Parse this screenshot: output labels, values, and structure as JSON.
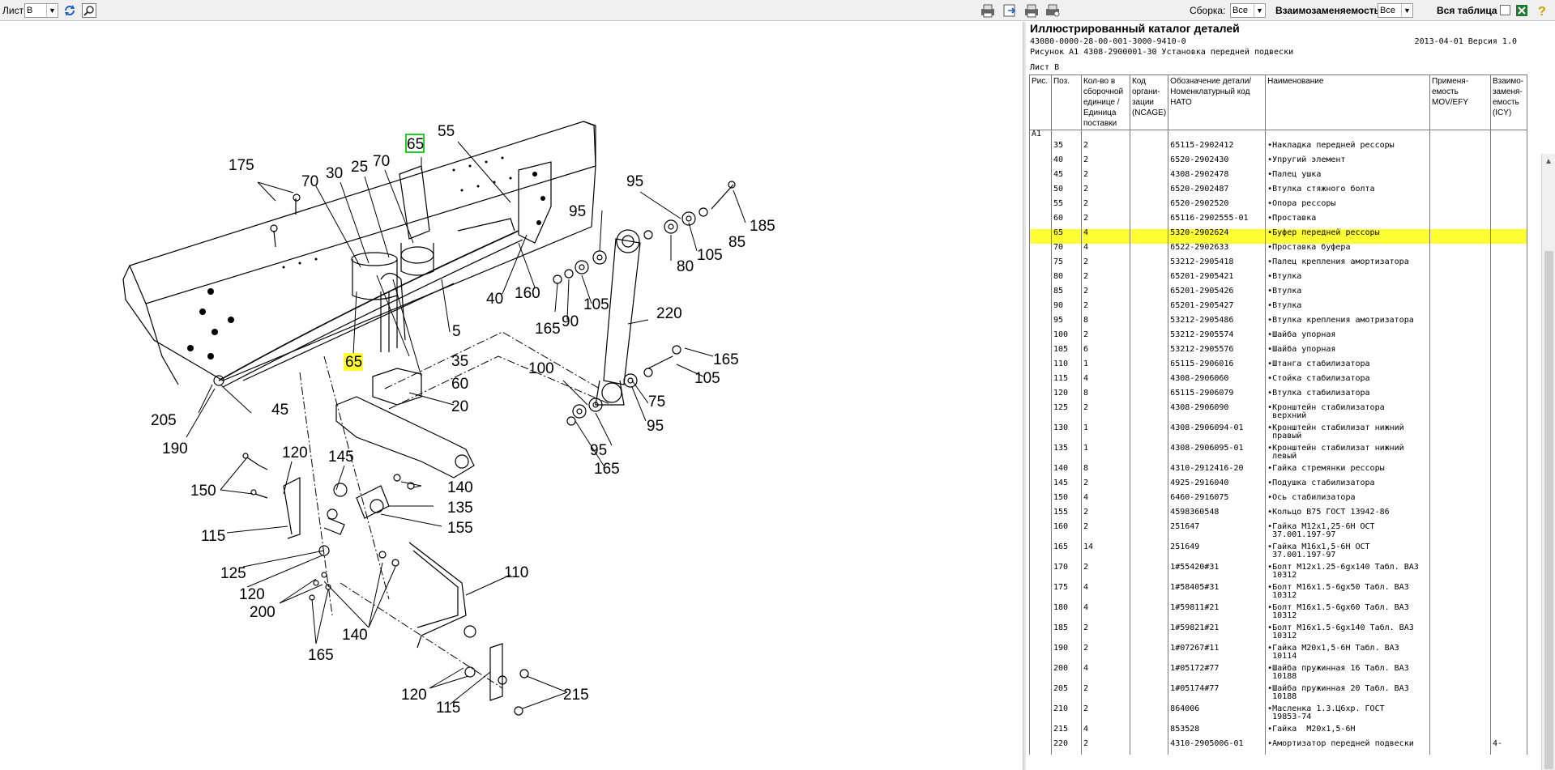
{
  "toolbar": {
    "sheet_label": "Лист",
    "sheet_value": "B",
    "assembly_label": "Сборка:",
    "assembly_value": "Все",
    "interchange_label": "Взаимозаменяемость:",
    "interchange_value": "Все",
    "full_table_label": "Вся таблица",
    "icons": [
      "refresh-icon",
      "zoom-icon",
      "print-icon",
      "export-icon",
      "print-preview-icon",
      "settings-print-icon",
      "checkbox",
      "excel-icon",
      "help-icon"
    ]
  },
  "catalog": {
    "title": "Иллюстрированный каталог деталей",
    "doc_code": "43080-0000-28-00-001-3000-9410-0",
    "date_version": "2013-04-01  Версия 1.0",
    "figure": "Рисунок A1  4308-2900001-30 Установка передней подвески",
    "sheet": "Лист  B",
    "headers": {
      "fig": "Рис.",
      "pos": "Поз.",
      "qty": "Кол-во в сборочной единице /Единица поставки",
      "ncage": "Код органи- зации (NCAGE)",
      "code": "Обозначение детали/ Номенклатурный код НАТО",
      "name": "Наименование",
      "mov": "Применя- емость MOV/EFY",
      "icy": "Взаимо- заменя- емость (ICY)"
    },
    "section": "A1",
    "rows": [
      {
        "pos": "35",
        "qty": "2",
        "code": "65115-2902412",
        "name": "•Накладка передней рессоры",
        "icy": ""
      },
      {
        "pos": "40",
        "qty": "2",
        "code": "6520-2902430",
        "name": "•Упругий элемент",
        "icy": ""
      },
      {
        "pos": "45",
        "qty": "2",
        "code": "4308-2902478",
        "name": "•Палец ушка",
        "icy": ""
      },
      {
        "pos": "50",
        "qty": "2",
        "code": "6520-2902487",
        "name": "•Втулка стяжного болта",
        "icy": ""
      },
      {
        "pos": "55",
        "qty": "2",
        "code": "6520-2902520",
        "name": "•Опора рессоры",
        "icy": ""
      },
      {
        "pos": "60",
        "qty": "2",
        "code": "65116-2902555-01",
        "name": "•Проставка",
        "icy": ""
      },
      {
        "pos": "65",
        "qty": "4",
        "code": "5320-2902624",
        "name": "•Буфер передней рессоры",
        "icy": "",
        "highlight": true
      },
      {
        "pos": "70",
        "qty": "4",
        "code": "6522-2902633",
        "name": "•Проставка буфера",
        "icy": ""
      },
      {
        "pos": "75",
        "qty": "2",
        "code": "53212-2905418",
        "name": "•Палец крепления амортизатора",
        "icy": ""
      },
      {
        "pos": "80",
        "qty": "2",
        "code": "65201-2905421",
        "name": "•Втулка",
        "icy": ""
      },
      {
        "pos": "85",
        "qty": "2",
        "code": "65201-2905426",
        "name": "•Втулка",
        "icy": ""
      },
      {
        "pos": "90",
        "qty": "2",
        "code": "65201-2905427",
        "name": "•Втулка",
        "icy": ""
      },
      {
        "pos": "95",
        "qty": "8",
        "code": "53212-2905486",
        "name": "•Втулка крепления амотризатора",
        "icy": ""
      },
      {
        "pos": "100",
        "qty": "2",
        "code": "53212-2905574",
        "name": "•Шайба упорная",
        "icy": ""
      },
      {
        "pos": "105",
        "qty": "6",
        "code": "53212-2905576",
        "name": "•Шайба упорная",
        "icy": ""
      },
      {
        "pos": "110",
        "qty": "1",
        "code": "65115-2906016",
        "name": "•Штанга стабилизатора",
        "icy": ""
      },
      {
        "pos": "115",
        "qty": "4",
        "code": "4308-2906060",
        "name": "•Стойка стабилизатора",
        "icy": ""
      },
      {
        "pos": "120",
        "qty": "8",
        "code": "65115-2906079",
        "name": "•Втулка стабилизатора",
        "icy": ""
      },
      {
        "pos": "125",
        "qty": "2",
        "code": "4308-2906090",
        "name": "•Кронштейн стабилизатора\n верхний",
        "icy": ""
      },
      {
        "pos": "130",
        "qty": "1",
        "code": "4308-2906094-01",
        "name": "•Кронштейн стабилизат нижний\n правый",
        "icy": ""
      },
      {
        "pos": "135",
        "qty": "1",
        "code": "4308-2906095-01",
        "name": "•Кронштейн стабилизат нижний\n левый",
        "icy": ""
      },
      {
        "pos": "140",
        "qty": "8",
        "code": "4310-2912416-20",
        "name": "•Гайка стремянки рессоры",
        "icy": ""
      },
      {
        "pos": "145",
        "qty": "2",
        "code": "4925-2916040",
        "name": "•Подушка стабилизатора",
        "icy": ""
      },
      {
        "pos": "150",
        "qty": "4",
        "code": "6460-2916075",
        "name": "•Ось стабилизатора",
        "icy": ""
      },
      {
        "pos": "155",
        "qty": "2",
        "code": "4598360548",
        "name": "•Кольцо B75 ГОСТ 13942-86",
        "icy": ""
      },
      {
        "pos": "160",
        "qty": "2",
        "code": "251647",
        "name": "•Гайка М12х1,25-6Н ОСТ\n 37.001.197-97",
        "icy": ""
      },
      {
        "pos": "165",
        "qty": "14",
        "code": "251649",
        "name": "•Гайка М16х1,5-6Н ОСТ\n 37.001.197-97",
        "icy": ""
      },
      {
        "pos": "170",
        "qty": "2",
        "code": "1#55420#31",
        "name": "•Болт М12х1.25-6gх140 Табл. ВАЗ\n 10312",
        "icy": ""
      },
      {
        "pos": "175",
        "qty": "4",
        "code": "1#58405#31",
        "name": "•Болт М16х1.5-6gх50 Табл. ВАЗ\n 10312",
        "icy": ""
      },
      {
        "pos": "180",
        "qty": "4",
        "code": "1#59811#21",
        "name": "•Болт М16х1.5-6gх60 Табл. ВАЗ\n 10312",
        "icy": ""
      },
      {
        "pos": "185",
        "qty": "2",
        "code": "1#59821#21",
        "name": "•Болт М16х1.5-6gх140 Табл. ВАЗ\n 10312",
        "icy": ""
      },
      {
        "pos": "190",
        "qty": "2",
        "code": "1#07267#11",
        "name": "•Гайка М20х1,5-6Н Табл. ВАЗ\n 10114",
        "icy": ""
      },
      {
        "pos": "200",
        "qty": "4",
        "code": "1#05172#77",
        "name": "•Шайба пружинная 16 Табл. ВАЗ\n 10188",
        "icy": ""
      },
      {
        "pos": "205",
        "qty": "2",
        "code": "1#05174#77",
        "name": "•Шайба пружинная 20 Табл. ВАЗ\n 10188",
        "icy": ""
      },
      {
        "pos": "210",
        "qty": "2",
        "code": "864006",
        "name": "•Масленка 1.3.Ц6хр. ГОСТ\n 19853-74",
        "icy": ""
      },
      {
        "pos": "215",
        "qty": "4",
        "code": "853528",
        "name": "•Гайка  М20х1,5-6Н",
        "icy": ""
      },
      {
        "pos": "220",
        "qty": "2",
        "code": "4310-2905006-01",
        "name": "•Амортизатор передней подвески",
        "icy": "4-"
      }
    ]
  },
  "drawing": {
    "callouts": [
      "175",
      "70",
      "30",
      "25",
      "70",
      "65",
      "55",
      "95",
      "95",
      "185",
      "85",
      "105",
      "80",
      "40",
      "160",
      "165",
      "90",
      "105",
      "220",
      "65",
      "35",
      "60",
      "5",
      "20",
      "100",
      "45",
      "205",
      "190",
      "105",
      "165",
      "75",
      "95",
      "165",
      "120",
      "145",
      "140",
      "150",
      "135",
      "155",
      "115",
      "110",
      "125",
      "120",
      "200",
      "140",
      "165",
      "120",
      "115",
      "215"
    ]
  }
}
